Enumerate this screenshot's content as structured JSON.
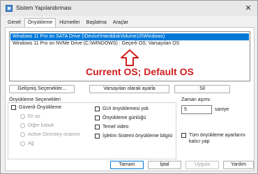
{
  "window": {
    "title": "Sistem Yapılandırması",
    "close_glyph": "✕"
  },
  "tabs": [
    {
      "label": "Genel"
    },
    {
      "label": "Önyükleme"
    },
    {
      "label": "Hizmetler"
    },
    {
      "label": "Başlatma"
    },
    {
      "label": "Araçlar"
    }
  ],
  "os_list": [
    {
      "text": "Windows 11 Pro on SATA Drive (\\Device\\HarddiskVolume10\\Windows)",
      "selected": true
    },
    {
      "text": "Windows 11 Pro on NVMe Drive (C:\\WINDOWS) : Geçerli OS; Varsayılan OS",
      "selected": false
    }
  ],
  "annotation": {
    "text": "Current OS; Default OS",
    "color": "#d01e1e"
  },
  "buttons": {
    "advanced": "Gelişmiş Seçenekler...",
    "set_default": "Varsayılan olarak ayarla",
    "delete": "Sil",
    "ok": "Tamam",
    "cancel": "İptal",
    "apply": "Uygula",
    "help": "Yardım"
  },
  "boot_options": {
    "label": "Önyükleme Seçenekleri",
    "safe_boot": "Güvenli Önyükleme",
    "minimal": "En az",
    "alternate_shell": "Diğer kabuk",
    "ad_repair": "Active Directory onarımı",
    "network": "Ağ",
    "no_gui_boot": "GUI önyüklemesi yok",
    "boot_log": "Önyükleme günlüğü",
    "base_video": "Temel video",
    "os_boot_info": "İşletim Sistemi önyükleme bilgisi",
    "make_permanent": "Tüm önyükleme ayarlarını kalıcı yap"
  },
  "timeout": {
    "label": "Zaman aşımı:",
    "value": "5",
    "unit": "saniye"
  },
  "colors": {
    "selection": "#0078d7",
    "accent": "#0078d7"
  }
}
